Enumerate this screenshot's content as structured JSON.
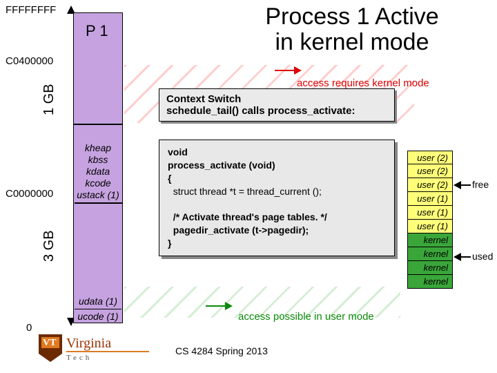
{
  "title_line1": "Process 1 Active",
  "title_line2": "in kernel mode",
  "addresses": {
    "top": "FFFFFFFF",
    "kboundary": "C0400000",
    "uboundary": "C0000000",
    "bottom": "0"
  },
  "proc_label": "P 1",
  "sizes": {
    "kernel": "1 GB",
    "user": "3 GB"
  },
  "kernel_segments": [
    "kheap",
    "kbss",
    "kdata",
    "kcode",
    "ustack (1)"
  ],
  "user_segments": [
    "udata (1)",
    "ucode (1)"
  ],
  "context_box": {
    "l1": "Context Switch",
    "l2": "schedule_tail() calls process_activate:"
  },
  "code": {
    "l1": "void",
    "l2": "process_activate (void)",
    "l3": "{",
    "l4": "  struct thread *t = thread_current ();",
    "l5": " ",
    "l6": "  /* Activate thread's page tables. */",
    "l7": "  pagedir_activate (t->pagedir);",
    "l8": "}"
  },
  "notes": {
    "kernel": "access requires kernel mode",
    "user": "access possible in user mode"
  },
  "page_table": {
    "rows": [
      "user (2)",
      "user (2)",
      "user (2)",
      "user (1)",
      "user (1)",
      "user (1)",
      "kernel",
      "kernel",
      "kernel",
      "kernel"
    ],
    "status": [
      "free",
      "free",
      "free",
      "free",
      "free",
      "free",
      "used",
      "used",
      "used",
      "used"
    ]
  },
  "legend": {
    "free": "free",
    "used": "used"
  },
  "footer": {
    "course": "CS 4284 Spring 2013",
    "school": "Virginia",
    "sub": "Tech"
  }
}
